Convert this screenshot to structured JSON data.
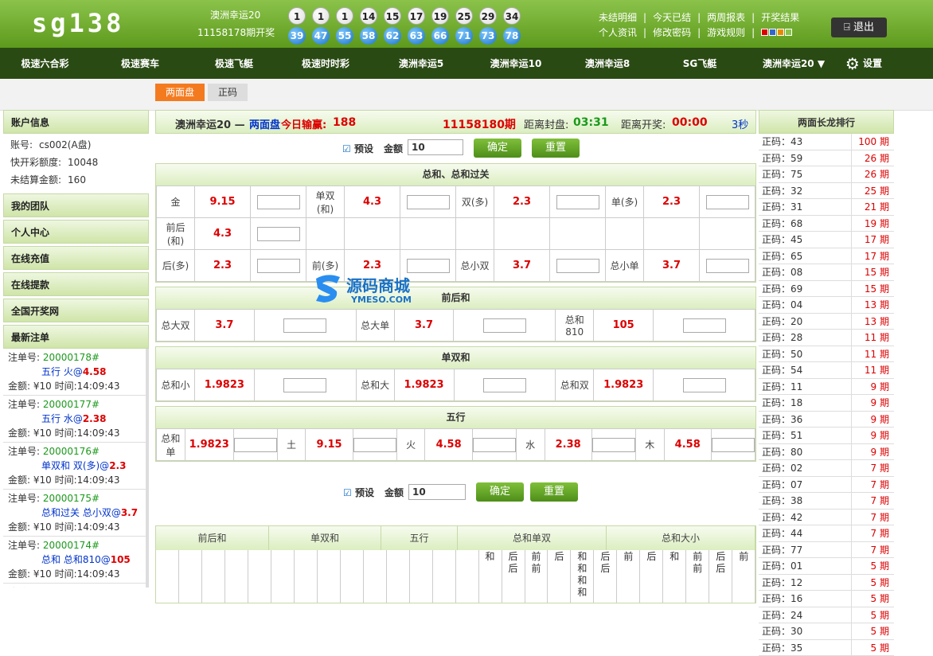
{
  "header": {
    "logo": "sg138",
    "lottery_name": "澳洲幸运20",
    "issue_text": "11158178期开奖",
    "balls_row1": [
      "1",
      "1",
      "1",
      "14",
      "15",
      "17",
      "19",
      "25",
      "29",
      "34"
    ],
    "balls_row2": [
      "39",
      "47",
      "55",
      "58",
      "62",
      "63",
      "66",
      "71",
      "73",
      "78"
    ],
    "links_row1": [
      "未结明细",
      "今天已结",
      "两周报表",
      "开奖结果"
    ],
    "links_row2": [
      "个人资讯",
      "修改密码",
      "游戏规则"
    ],
    "logout": "退出"
  },
  "nav": [
    "极速六合彩",
    "极速赛车",
    "极速飞艇",
    "极速时时彩",
    "澳洲幸运5",
    "澳洲幸运10",
    "澳洲幸运8",
    "SG飞艇",
    "澳洲幸运20 ▼",
    "设置"
  ],
  "tabs": [
    "两面盘",
    "正码"
  ],
  "left": {
    "account_title": "账户信息",
    "account_no_label": "账号:",
    "account_no": "cs002(A盘)",
    "credit_label": "快开彩额度:",
    "credit": "10048",
    "unsettled_label": "未结算金额:",
    "unsettled": "160",
    "menu": [
      "我的团队",
      "个人中心",
      "在线充值",
      "在线提款",
      "全国开奖网"
    ],
    "bets_title": "最新注单",
    "bets": [
      {
        "no": "20000178#",
        "play": "五行 火@",
        "odd": "4.58",
        "amount": "金额: ¥10  时间:14:09:43"
      },
      {
        "no": "20000177#",
        "play": "五行 水@",
        "odd": "2.38",
        "amount": "金额: ¥10  时间:14:09:43"
      },
      {
        "no": "20000176#",
        "play": "单双和 双(多)@",
        "odd": "2.3",
        "amount": "金额: ¥10  时间:14:09:43"
      },
      {
        "no": "20000175#",
        "play": "总和过关 总小双@",
        "odd": "3.7",
        "amount": "金额: ¥10  时间:14:09:43"
      },
      {
        "no": "20000174#",
        "play": "总和 总和810@",
        "odd": "105",
        "amount": "金额: ¥10  时间:14:09:43"
      },
      {
        "no": "20000173#",
        "play": "",
        "odd": "",
        "amount": ""
      }
    ],
    "bet_label": "注单号:"
  },
  "main": {
    "info_game": "澳洲幸运20 —",
    "info_mode": "两面盘",
    "info_win_label": "今日输赢:",
    "info_win": "188",
    "info_issue": "11158180期",
    "info_close_label": "距离封盘:",
    "info_close": "03:31",
    "info_open_label": "距离开奖:",
    "info_open": "00:00",
    "info_refresh": "3秒",
    "preset_label": "预设",
    "amount_label": "金额",
    "amount_value": "10",
    "confirm": "确定",
    "reset": "重置",
    "sec1_title": "总和、总和过关",
    "sec1_row1": [
      [
        "金",
        "9.15"
      ],
      [
        "单双\n(和)",
        "4.3"
      ],
      [
        "双(多)",
        "2.3"
      ],
      [
        "单(多)",
        "2.3"
      ]
    ],
    "sec1_row2": [
      [
        "前后\n(和)",
        "4.3"
      ]
    ],
    "sec1_row3": [
      [
        "后(多)",
        "2.3"
      ],
      [
        "前(多)",
        "2.3"
      ],
      [
        "总小双",
        "3.7"
      ],
      [
        "总小单",
        "3.7"
      ]
    ],
    "sec2_title": "前后和",
    "sec2_row": [
      [
        "总大双",
        "3.7"
      ],
      [
        "总大单",
        "3.7"
      ],
      [
        "总和\n810",
        "105"
      ]
    ],
    "sec3_title": "单双和",
    "sec3_row": [
      [
        "总和小",
        "1.9823"
      ],
      [
        "总和大",
        "1.9823"
      ],
      [
        "总和双",
        "1.9823"
      ]
    ],
    "sec4_title": "五行",
    "sec4_row": [
      [
        "总和\n单",
        "1.9823"
      ],
      [
        "土",
        "9.15"
      ],
      [
        "火",
        "4.58"
      ],
      [
        "水",
        "2.38"
      ],
      [
        "木",
        "4.58"
      ]
    ],
    "hist_headers": [
      "前后和",
      "单双和",
      "五行",
      "总和单双",
      "总和大小"
    ],
    "hist_cells": [
      "",
      "",
      "",
      "",
      "",
      "",
      "",
      "",
      "",
      "",
      "",
      "",
      "",
      "",
      "和",
      "后\n后",
      "前\n前",
      "后",
      "和\n和\n和\n和",
      "后\n后",
      "前",
      "后",
      "和",
      "前\n前",
      "后\n后",
      "前"
    ]
  },
  "right": {
    "title": "两面长龙排行",
    "rows": [
      [
        "正码：43",
        "100 期"
      ],
      [
        "正码：59",
        "26 期"
      ],
      [
        "正码：75",
        "26 期"
      ],
      [
        "正码：32",
        "25 期"
      ],
      [
        "正码：31",
        "21 期"
      ],
      [
        "正码：68",
        "19 期"
      ],
      [
        "正码：45",
        "17 期"
      ],
      [
        "正码：65",
        "17 期"
      ],
      [
        "正码：08",
        "15 期"
      ],
      [
        "正码：69",
        "15 期"
      ],
      [
        "正码：04",
        "13 期"
      ],
      [
        "正码：20",
        "13 期"
      ],
      [
        "正码：28",
        "11 期"
      ],
      [
        "正码：50",
        "11 期"
      ],
      [
        "正码：54",
        "11 期"
      ],
      [
        "正码：11",
        "9 期"
      ],
      [
        "正码：18",
        "9 期"
      ],
      [
        "正码：36",
        "9 期"
      ],
      [
        "正码：51",
        "9 期"
      ],
      [
        "正码：80",
        "9 期"
      ],
      [
        "正码：02",
        "7 期"
      ],
      [
        "正码：07",
        "7 期"
      ],
      [
        "正码：38",
        "7 期"
      ],
      [
        "正码：42",
        "7 期"
      ],
      [
        "正码：44",
        "7 期"
      ],
      [
        "正码：77",
        "7 期"
      ],
      [
        "正码：01",
        "5 期"
      ],
      [
        "正码：12",
        "5 期"
      ],
      [
        "正码：16",
        "5 期"
      ],
      [
        "正码：24",
        "5 期"
      ],
      [
        "正码：30",
        "5 期"
      ],
      [
        "正码：35",
        "5 期"
      ]
    ]
  },
  "watermark": {
    "cn": "源码商城",
    "en": "YMESO.COM"
  },
  "colors": {
    "accent": "#d00000",
    "green_time": "#1a9a1a",
    "blue": "#0033cc"
  }
}
